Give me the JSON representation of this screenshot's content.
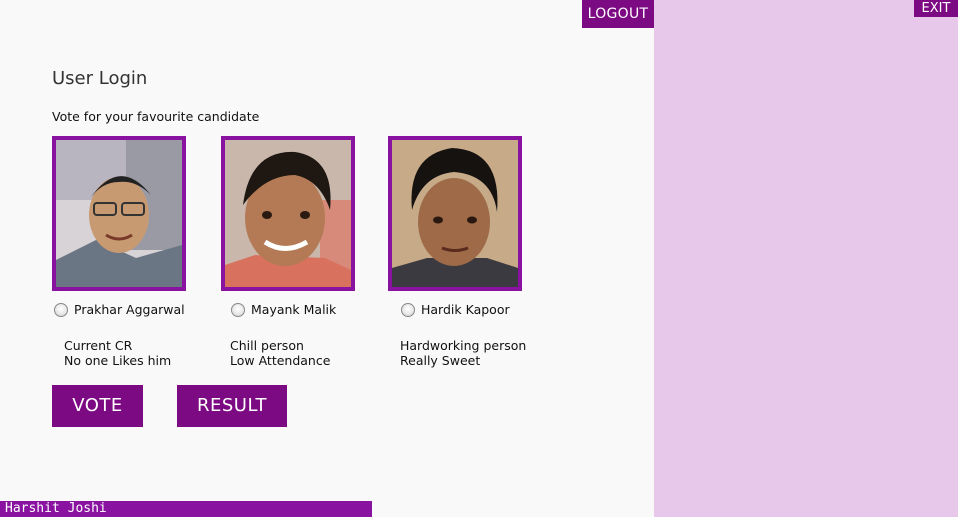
{
  "header": {
    "logout_label": "LOGOUT",
    "exit_label": "EXIT"
  },
  "main": {
    "title": "User Login",
    "instruction": "Vote for your favourite candidate",
    "candidates": [
      {
        "name": "Prakhar Aggarwal",
        "desc_line1": "Current CR",
        "desc_line2": "No one Likes him"
      },
      {
        "name": "Mayank Malik",
        "desc_line1": "Chill person",
        "desc_line2": "Low Attendance"
      },
      {
        "name": "Hardik Kapoor",
        "desc_line1": "Hardworking person",
        "desc_line2": "Really Sweet"
      }
    ],
    "vote_label": "VOTE",
    "result_label": "RESULT"
  },
  "footer": {
    "author": "Harshit Joshi"
  },
  "colors": {
    "accent": "#7c0a83",
    "frame": "#8a12a0",
    "side_panel": "#e8c8ea",
    "background": "#f9f9f9"
  }
}
